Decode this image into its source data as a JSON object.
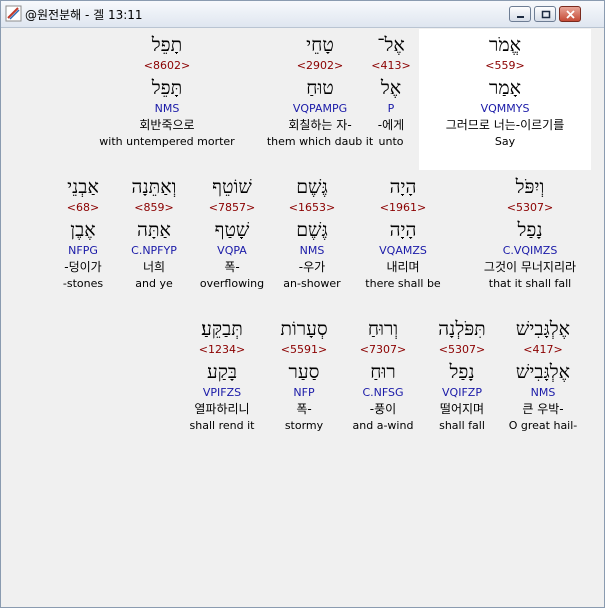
{
  "window": {
    "title": "@원전분해 - 겔 13:11"
  },
  "rows": [
    [
      {
        "heb": "אֱמֹר",
        "strong": "<559>",
        "lemma": "אָמַר",
        "parse": "VQMMYS",
        "kor": "그러므로 너는-이르기를",
        "eng": "Say"
      },
      {
        "heb": "אֶל־",
        "strong": "<413>",
        "lemma": "אֶל",
        "parse": "P",
        "kor": "-에게",
        "eng": "unto"
      },
      {
        "heb": "טָחֵי",
        "strong": "<2902>",
        "lemma": "טוּחַ",
        "parse": "VQPAMPG",
        "kor": "회칠하는 자-",
        "eng": "them which daub it"
      },
      {
        "heb": "תָפֵל",
        "strong": "<8602>",
        "lemma": "תָּפֵל",
        "parse": "NMS",
        "kor": "회반죽으로",
        "eng": "with untempered morter"
      }
    ],
    [
      {
        "heb": "וְיִפֹּל",
        "strong": "<5307>",
        "lemma": "נָפַל",
        "parse": "C.VQIMZS",
        "kor": "그것이 무너지리라",
        "eng": "that it shall fall"
      },
      {
        "heb": "הָיָה",
        "strong": "<1961>",
        "lemma": "הָיָה",
        "parse": "VQAMZS",
        "kor": "내리며",
        "eng": "there shall be"
      },
      {
        "heb": "גֶּשֶׁם",
        "strong": "<1653>",
        "lemma": "גֶּשֶׁם",
        "parse": "NMS",
        "kor": "-우가",
        "eng": "an-shower"
      },
      {
        "heb": "שׁוֹטֵף",
        "strong": "<7857>",
        "lemma": "שָׁטַף",
        "parse": "VQPA",
        "kor": "폭-",
        "eng": "overflowing"
      },
      {
        "heb": "וְאַתֵּנָה",
        "strong": "<859>",
        "lemma": "אַתָּה",
        "parse": "C.NPFYP",
        "kor": "너희",
        "eng": "and ye"
      },
      {
        "heb": "אַבְנֵי",
        "strong": "<68>",
        "lemma": "אֶבֶן",
        "parse": "NFPG",
        "kor": "-덩이가",
        "eng": "-stones"
      }
    ],
    [
      {
        "heb": "אֶלְגָּבִישׁ",
        "strong": "<417>",
        "lemma": "אֶלְגָּבִישׁ",
        "parse": "NMS",
        "kor": "큰 우박-",
        "eng": "O great hail-"
      },
      {
        "heb": "תִּפֹּלְנָה",
        "strong": "<5307>",
        "lemma": "נָפַל",
        "parse": "VQIFZP",
        "kor": "떨어지며",
        "eng": "shall fall"
      },
      {
        "heb": "וְרוּחַ",
        "strong": "<7307>",
        "lemma": "רוּחַ",
        "parse": "C.NFSG",
        "kor": "-풍이",
        "eng": "and a-wind"
      },
      {
        "heb": "סְעָרוֹת",
        "strong": "<5591>",
        "lemma": "סַעַר",
        "parse": "NFP",
        "kor": "폭-",
        "eng": "stormy"
      },
      {
        "heb": "תְּבַקֵּעַ׃",
        "strong": "<1234>",
        "lemma": "בָּקַע",
        "parse": "VPIFZS",
        "kor": "열파하리니",
        "eng": "shall rend it"
      }
    ]
  ]
}
